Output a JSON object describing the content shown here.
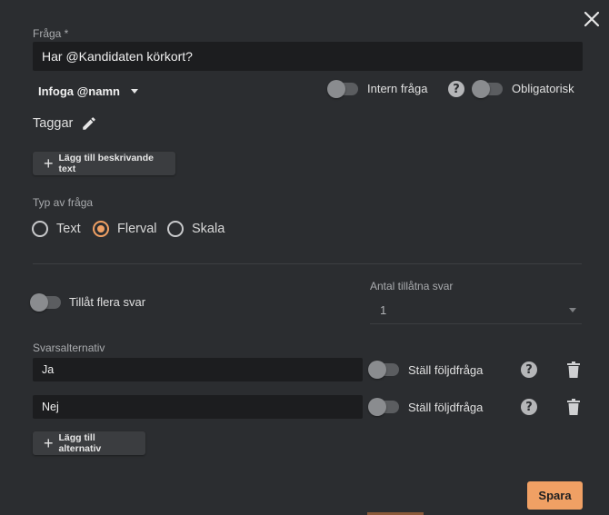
{
  "question": {
    "label": "Fråga *",
    "value": "Har @Kandidaten körkort?"
  },
  "insert_name": {
    "label": "Infoga @namn"
  },
  "toggles": {
    "internal_label": "Intern fråga",
    "mandatory_label": "Obligatorisk",
    "allow_multiple_label": "Tillåt flera svar"
  },
  "tags": {
    "label": "Taggar"
  },
  "add_description_button": {
    "label": "Lägg till beskrivande text"
  },
  "question_type": {
    "label": "Typ av fråga",
    "options": [
      {
        "label": "Text",
        "checked": false
      },
      {
        "label": "Flerval",
        "checked": true
      },
      {
        "label": "Skala",
        "checked": false
      }
    ]
  },
  "allowed_answers": {
    "label": "Antal tillåtna svar",
    "value": "1"
  },
  "answers": {
    "label": "Svarsalternativ",
    "follow_up_label": "Ställ följdfråga",
    "items": [
      {
        "value": "Ja"
      },
      {
        "value": "Nej"
      }
    ]
  },
  "add_alternative_button": {
    "label": "Lägg till alternativ"
  },
  "save_button": {
    "label": "Spara"
  },
  "colors": {
    "background": "#2b2d30",
    "field": "#1c1d1f",
    "accent": "#f0a064"
  }
}
